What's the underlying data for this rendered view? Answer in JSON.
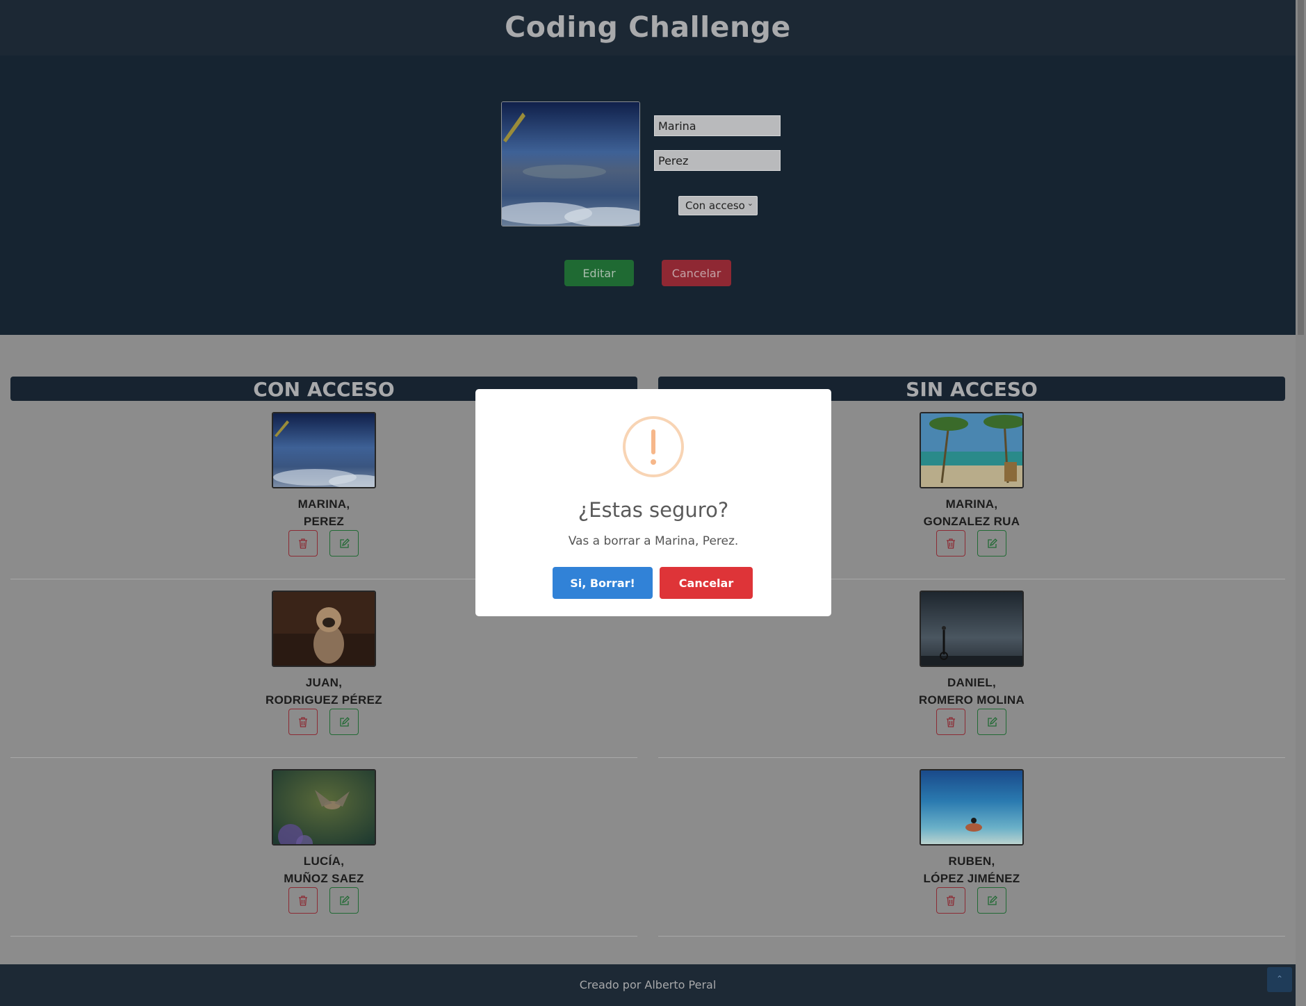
{
  "header": {
    "title": "Coding Challenge"
  },
  "editor": {
    "name_value": "Marina",
    "surname_value": "Perez",
    "access_selected": "Con acceso",
    "edit_label": "Editar",
    "cancel_label": "Cancelar"
  },
  "lists": {
    "with_access": {
      "title": "CON ACCESO",
      "people": [
        {
          "first": "MARINA,",
          "last": "PEREZ"
        },
        {
          "first": "JUAN,",
          "last": "RODRIGUEZ PÉREZ"
        },
        {
          "first": "LUCÍA,",
          "last": "MUÑOZ SAEZ"
        }
      ]
    },
    "without_access": {
      "title": "SIN ACCESO",
      "people": [
        {
          "first": "MARINA,",
          "last": "GONZALEZ RUA"
        },
        {
          "first": "DANIEL,",
          "last": "ROMERO MOLINA"
        },
        {
          "first": "RUBEN,",
          "last": "LÓPEZ JIMÉNEZ"
        }
      ]
    }
  },
  "footer": {
    "text": "Creado por Alberto Peral"
  },
  "modal": {
    "title": "¿Estas seguro?",
    "message": "Vas a borrar a Marina, Perez.",
    "confirm_label": "Si, Borrar!",
    "cancel_label": "Cancelar"
  },
  "colors": {
    "header_bg": "#1c2834",
    "overlay_bg": "#8c8c8c",
    "confirm": "#3182d7",
    "cancel": "#de3438",
    "warning": "#f6b78a"
  }
}
